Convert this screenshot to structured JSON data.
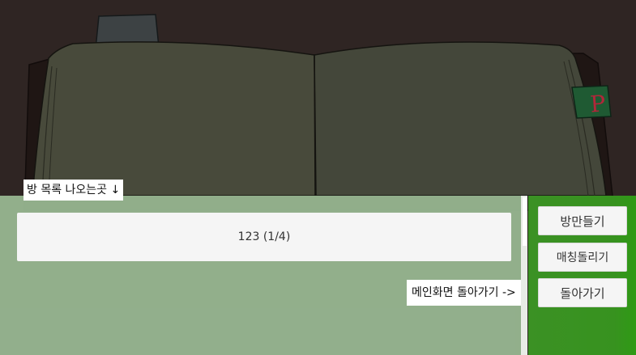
{
  "room_list": {
    "label": "방 목록 나오는곳 ↓",
    "rooms": [
      {
        "text": "123 (1/4)"
      }
    ]
  },
  "buttons": {
    "make_room": "방만들기",
    "matching": "매칭돌리기",
    "back": "돌아가기"
  },
  "back_hint": "메인화면 돌아가기 ->",
  "book": {
    "tab_letter": "P"
  },
  "colors": {
    "background": "#2f2523",
    "book_page": "#4a4a3c",
    "list_panel": "#96b590",
    "side_panel": "#3b9124",
    "tab": "#1f5a33",
    "tab_letter": "#b3263a"
  }
}
